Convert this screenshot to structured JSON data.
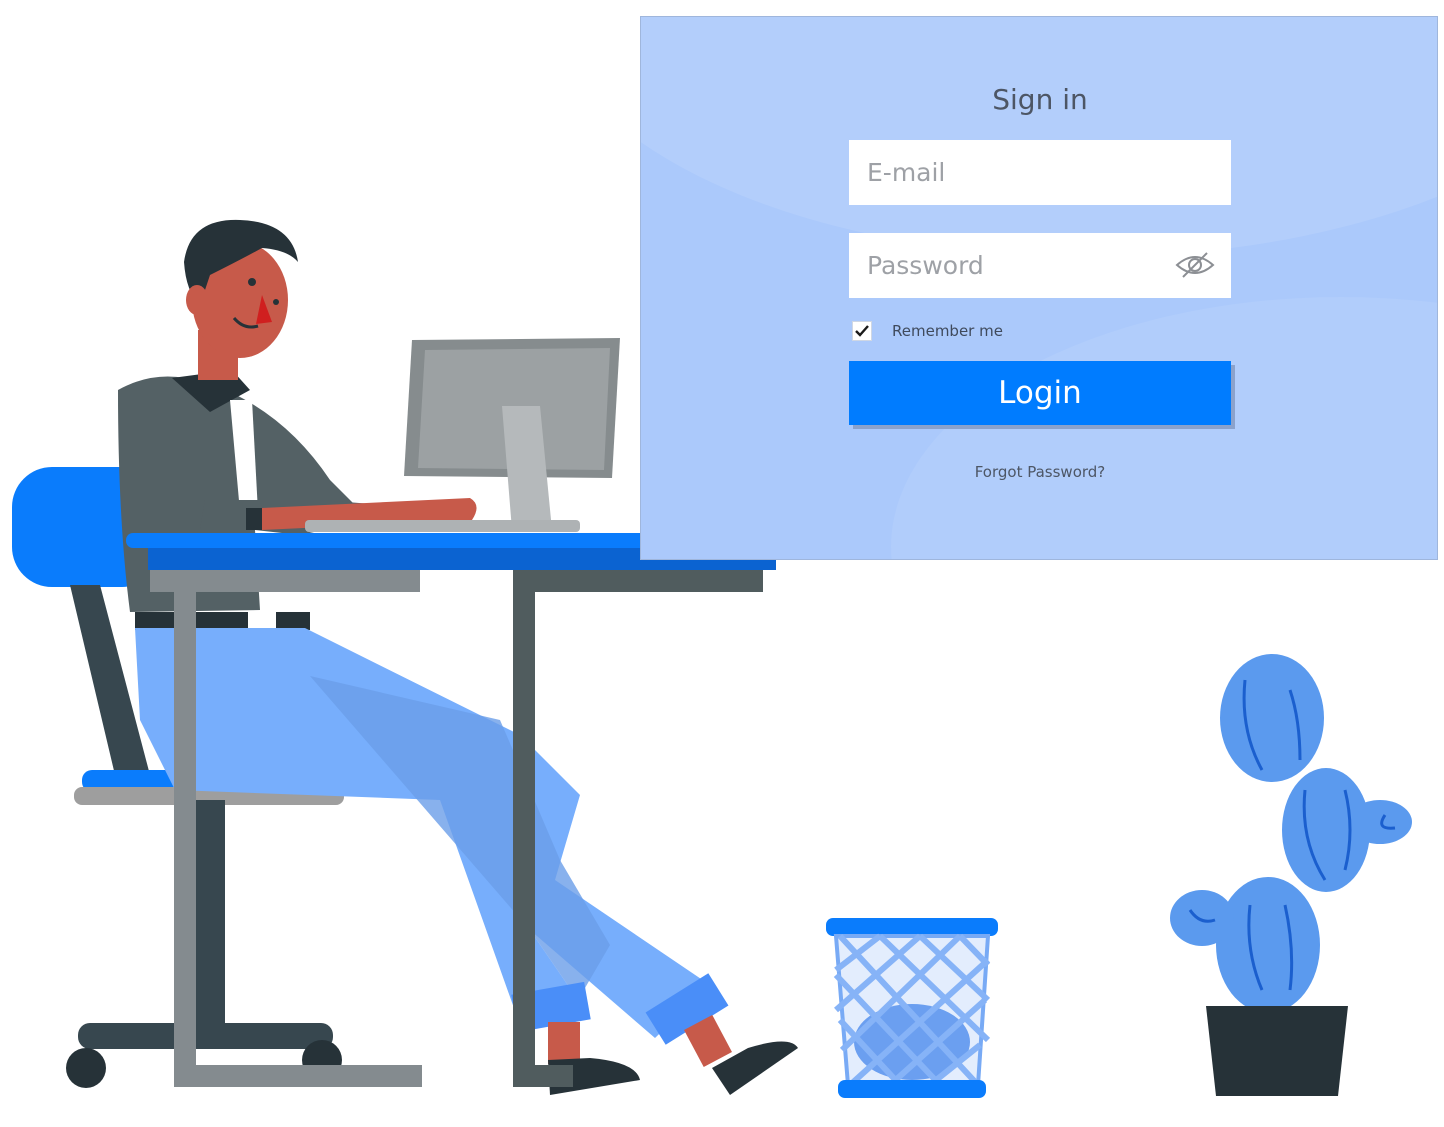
{
  "signin": {
    "title": "Sign in",
    "email_placeholder": "E-mail",
    "password_placeholder": "Password",
    "remember_label": "Remember me",
    "remember_checked": true,
    "login_label": "Login",
    "forgot_label": "Forgot Password?"
  },
  "icons": {
    "password_toggle": "eye-slash-icon",
    "checkbox_mark": "checkmark-icon"
  },
  "colors": {
    "panel_bg": "#abc9fb",
    "primary": "#007cff",
    "illustration_blue": "#77aefc",
    "illustration_dark": "#263238"
  }
}
